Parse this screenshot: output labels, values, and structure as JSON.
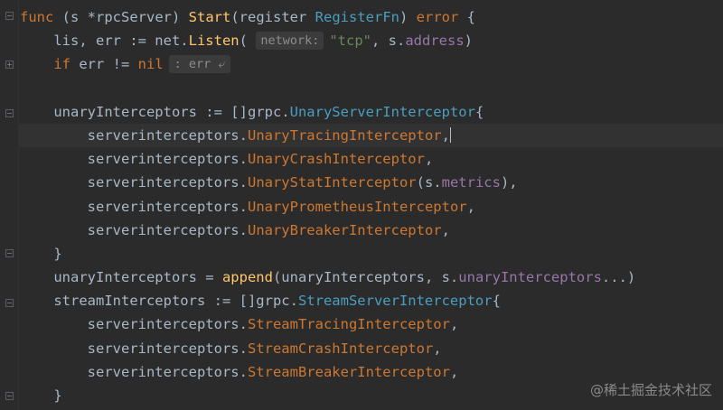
{
  "editor": {
    "lines": [
      [
        [
          "kw",
          "func "
        ],
        [
          "plain",
          "(s *"
        ],
        [
          "plain",
          "rpcServer"
        ],
        [
          "plain",
          ") "
        ],
        [
          "fn",
          "Start"
        ],
        [
          "plain",
          "(register "
        ],
        [
          "tyname",
          "RegisterFn"
        ],
        [
          "plain",
          ") "
        ],
        [
          "kw",
          "error"
        ],
        [
          "plain",
          " {"
        ]
      ],
      [
        [
          "plain",
          "    lis, err := net."
        ],
        [
          "fn",
          "Listen"
        ],
        [
          "plain",
          "( "
        ],
        [
          "hint",
          "network:"
        ],
        [
          "str",
          "\"tcp\""
        ],
        [
          "plain",
          ", s."
        ],
        [
          "fld",
          "address"
        ],
        [
          "plain",
          ")"
        ]
      ],
      [
        [
          "plain",
          "    "
        ],
        [
          "kw",
          "if "
        ],
        [
          "plain",
          "err != "
        ],
        [
          "kw",
          "nil"
        ],
        [
          "hint2",
          ": err ⤶"
        ]
      ],
      [
        [
          "plain",
          ""
        ]
      ],
      [
        [
          "plain",
          "    unaryInterceptors := []grpc."
        ],
        [
          "tyname",
          "UnaryServerInterceptor"
        ],
        [
          "plain",
          "{"
        ]
      ],
      [
        [
          "plain",
          "        "
        ],
        [
          "pkg",
          "serverinterceptors"
        ],
        [
          "plain",
          "."
        ],
        [
          "mem",
          "UnaryTracingInterceptor"
        ],
        [
          "plain",
          ","
        ],
        [
          "caret",
          ""
        ]
      ],
      [
        [
          "plain",
          "        "
        ],
        [
          "pkg",
          "serverinterceptors"
        ],
        [
          "plain",
          "."
        ],
        [
          "mem",
          "UnaryCrashInterceptor"
        ],
        [
          "plain",
          ","
        ]
      ],
      [
        [
          "plain",
          "        "
        ],
        [
          "pkg",
          "serverinterceptors"
        ],
        [
          "plain",
          "."
        ],
        [
          "mem",
          "UnaryStatInterceptor"
        ],
        [
          "plain",
          "(s."
        ],
        [
          "fld",
          "metrics"
        ],
        [
          "plain",
          "),"
        ]
      ],
      [
        [
          "plain",
          "        "
        ],
        [
          "pkg",
          "serverinterceptors"
        ],
        [
          "plain",
          "."
        ],
        [
          "mem",
          "UnaryPrometheusInterceptor"
        ],
        [
          "plain",
          ","
        ]
      ],
      [
        [
          "plain",
          "        "
        ],
        [
          "pkg",
          "serverinterceptors"
        ],
        [
          "plain",
          "."
        ],
        [
          "mem",
          "UnaryBreakerInterceptor"
        ],
        [
          "plain",
          ","
        ]
      ],
      [
        [
          "plain",
          "    }"
        ]
      ],
      [
        [
          "plain",
          "    unaryInterceptors = "
        ],
        [
          "fn",
          "append"
        ],
        [
          "plain",
          "(unaryInterceptors, s."
        ],
        [
          "fld",
          "unaryInterceptors"
        ],
        [
          "plain",
          "...)"
        ]
      ],
      [
        [
          "plain",
          "    streamInterceptors := []grpc."
        ],
        [
          "tyname",
          "StreamServerInterceptor"
        ],
        [
          "plain",
          "{"
        ]
      ],
      [
        [
          "plain",
          "        "
        ],
        [
          "pkg",
          "serverinterceptors"
        ],
        [
          "plain",
          "."
        ],
        [
          "mem",
          "StreamTracingInterceptor"
        ],
        [
          "plain",
          ","
        ]
      ],
      [
        [
          "plain",
          "        "
        ],
        [
          "pkg",
          "serverinterceptors"
        ],
        [
          "plain",
          "."
        ],
        [
          "mem",
          "StreamCrashInterceptor"
        ],
        [
          "plain",
          ","
        ]
      ],
      [
        [
          "plain",
          "        "
        ],
        [
          "pkg",
          "serverinterceptors"
        ],
        [
          "plain",
          "."
        ],
        [
          "mem",
          "StreamBreakerInterceptor"
        ],
        [
          "plain",
          ","
        ]
      ],
      [
        [
          "plain",
          "    }"
        ]
      ]
    ],
    "current_line": 5
  },
  "watermark": "@稀土掘金技术社区",
  "colors": {
    "background": "#2b2b2b",
    "keyword": "#cc7832",
    "function": "#ffc66d",
    "type": "#4a9ebf",
    "string": "#6a8759",
    "field": "#9876aa",
    "text": "#a9b7c6"
  }
}
